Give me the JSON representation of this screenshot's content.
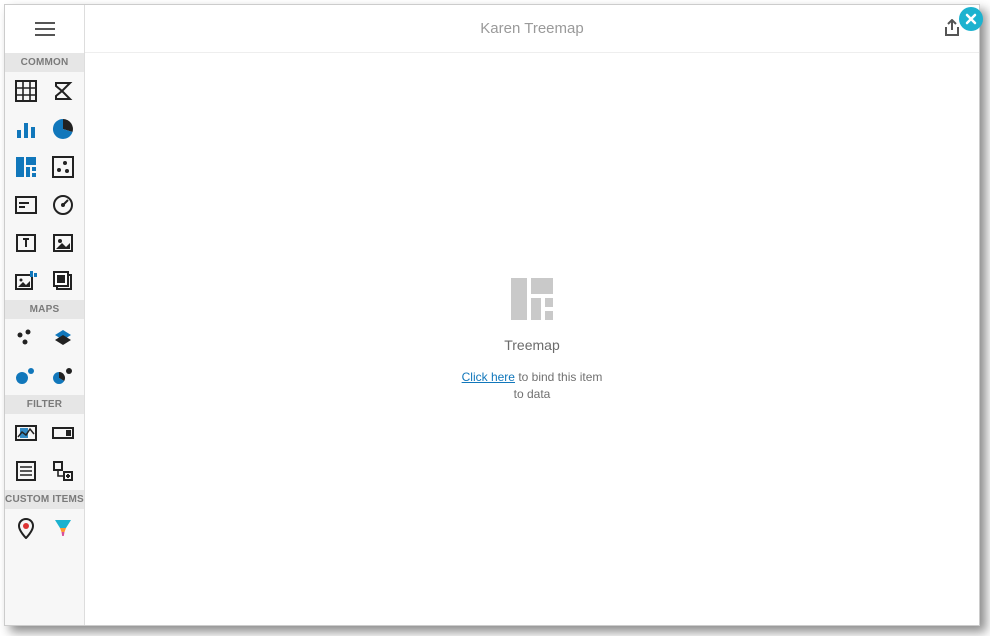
{
  "header": {
    "title": "Karen Treemap"
  },
  "sidebar": {
    "sections": {
      "common": "COMMON",
      "maps": "MAPS",
      "filter": "FILTER",
      "custom": "CUSTOM ITEMS"
    }
  },
  "empty": {
    "name": "Treemap",
    "link": "Click here",
    "rest": " to bind this item to data"
  }
}
